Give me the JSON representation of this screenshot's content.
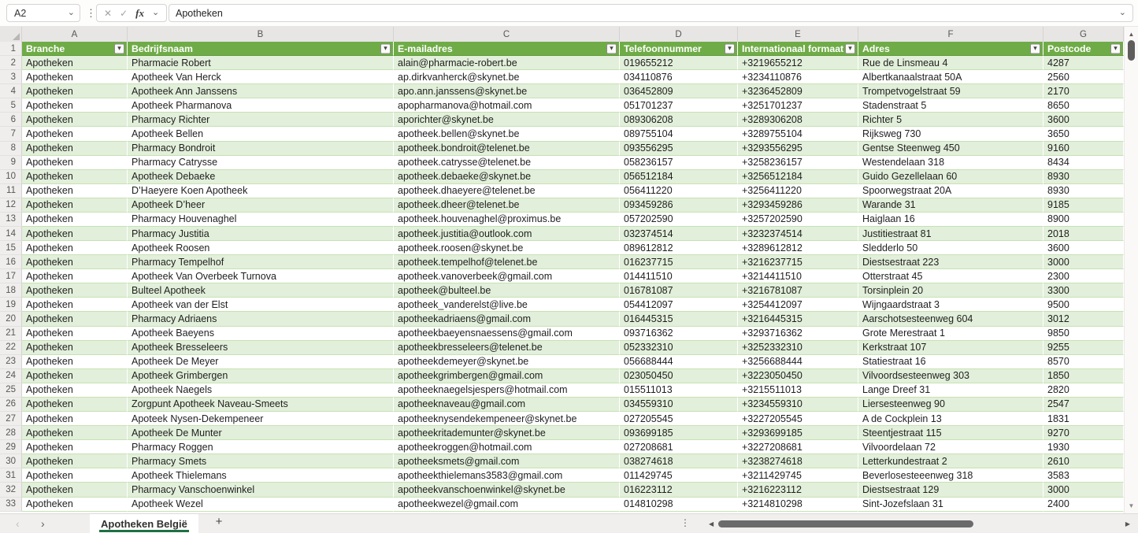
{
  "toolbar": {
    "name_box": "A2",
    "formula_value": "Apotheken",
    "fx_label": "fx"
  },
  "icons": {
    "chevron_down": "⌄",
    "more_vertical": "⋮",
    "cancel": "✕",
    "check": "✓",
    "filter_arrow": "▾",
    "nav_left": "‹",
    "nav_right": "›",
    "scroll_left": "◀",
    "scroll_right": "▶",
    "scroll_up": "▲",
    "scroll_down": "▼",
    "add_sheet": "+"
  },
  "colors": {
    "table_header_green": "#6FAC47",
    "band_green": "#E2EFDA",
    "row_border_green": "#C6E2B4",
    "tab_underline_green": "#1E7145"
  },
  "grid": {
    "column_letters": [
      "A",
      "B",
      "C",
      "D",
      "E",
      "F",
      "G"
    ],
    "headers": [
      "Branche",
      "Bedrijfsnaam",
      "E-mailadres",
      "Telefoonnummer",
      "Internationaal formaat",
      "Adres",
      "Postcode"
    ],
    "rows": [
      [
        "Apotheken",
        "Pharmacie Robert",
        "alain@pharmacie-robert.be",
        "019655212",
        "+3219655212",
        "Rue de Linsmeau 4",
        "4287"
      ],
      [
        "Apotheken",
        "Apotheek Van Herck",
        "ap.dirkvanherck@skynet.be",
        "034110876",
        "+3234110876",
        "Albertkanaalstraat 50A",
        "2560"
      ],
      [
        "Apotheken",
        "Apotheek Ann Janssens",
        "apo.ann.janssens@skynet.be",
        "036452809",
        "+3236452809",
        "Trompetvogelstraat 59",
        "2170"
      ],
      [
        "Apotheken",
        "Apotheek Pharmanova",
        "apopharmanova@hotmail.com",
        "051701237",
        "+3251701237",
        "Stadenstraat 5",
        "8650"
      ],
      [
        "Apotheken",
        "Pharmacy Richter",
        "aporichter@skynet.be",
        "089306208",
        "+3289306208",
        "Richter 5",
        "3600"
      ],
      [
        "Apotheken",
        "Apotheek Bellen",
        "apotheek.bellen@skynet.be",
        "089755104",
        "+3289755104",
        "Rijksweg 730",
        "3650"
      ],
      [
        "Apotheken",
        "Pharmacy Bondroit",
        "apotheek.bondroit@telenet.be",
        "093556295",
        "+3293556295",
        "Gentse Steenweg 450",
        "9160"
      ],
      [
        "Apotheken",
        "Pharmacy Catrysse",
        "apotheek.catrysse@telenet.be",
        "058236157",
        "+3258236157",
        "Westendelaan 318",
        "8434"
      ],
      [
        "Apotheken",
        "Apotheek Debaeke",
        "apotheek.debaeke@skynet.be",
        "056512184",
        "+3256512184",
        "Guido Gezellelaan 60",
        "8930"
      ],
      [
        "Apotheken",
        "D’Haeyere Koen Apotheek",
        "apotheek.dhaeyere@telenet.be",
        "056411220",
        "+3256411220",
        "Spoorwegstraat 20A",
        "8930"
      ],
      [
        "Apotheken",
        "Apotheek D’heer",
        "apotheek.dheer@telenet.be",
        "093459286",
        "+3293459286",
        "Warande 31",
        "9185"
      ],
      [
        "Apotheken",
        "Pharmacy Houvenaghel",
        "apotheek.houvenaghel@proximus.be",
        "057202590",
        "+3257202590",
        "Haiglaan 16",
        "8900"
      ],
      [
        "Apotheken",
        "Pharmacy Justitia",
        "apotheek.justitia@outlook.com",
        "032374514",
        "+3232374514",
        "Justitiestraat 81",
        "2018"
      ],
      [
        "Apotheken",
        "Apotheek Roosen",
        "apotheek.roosen@skynet.be",
        "089612812",
        "+3289612812",
        "Sledderlo 50",
        "3600"
      ],
      [
        "Apotheken",
        "Pharmacy Tempelhof",
        "apotheek.tempelhof@telenet.be",
        "016237715",
        "+3216237715",
        "Diestsestraat 223",
        "3000"
      ],
      [
        "Apotheken",
        "Apotheek Van Overbeek Turnova",
        "apotheek.vanoverbeek@gmail.com",
        "014411510",
        "+3214411510",
        "Otterstraat 45",
        "2300"
      ],
      [
        "Apotheken",
        "Bulteel Apotheek",
        "apotheek@bulteel.be",
        "016781087",
        "+3216781087",
        "Torsinplein 20",
        "3300"
      ],
      [
        "Apotheken",
        "Apotheek van der Elst",
        "apotheek_vanderelst@live.be",
        "054412097",
        "+3254412097",
        "Wijngaardstraat 3",
        "9500"
      ],
      [
        "Apotheken",
        "Pharmacy Adriaens",
        "apotheekadriaens@gmail.com",
        "016445315",
        "+3216445315",
        "Aarschotsesteenweg 604",
        "3012"
      ],
      [
        "Apotheken",
        "Apotheek Baeyens",
        "apotheekbaeyensnaessens@gmail.com",
        "093716362",
        "+3293716362",
        "Grote Merestraat 1",
        "9850"
      ],
      [
        "Apotheken",
        "Apotheek Bresseleers",
        "apotheekbresseleers@telenet.be",
        "052332310",
        "+3252332310",
        "Kerkstraat 107",
        "9255"
      ],
      [
        "Apotheken",
        "Apotheek De Meyer",
        "apotheekdemeyer@skynet.be",
        "056688444",
        "+3256688444",
        "Statiestraat 16",
        "8570"
      ],
      [
        "Apotheken",
        "Apotheek Grimbergen",
        "apotheekgrimbergen@gmail.com",
        "023050450",
        "+3223050450",
        "Vilvoordsesteenweg 303",
        "1850"
      ],
      [
        "Apotheken",
        "Apotheek Naegels",
        "apotheeknaegelsjespers@hotmail.com",
        "015511013",
        "+3215511013",
        "Lange Dreef 31",
        "2820"
      ],
      [
        "Apotheken",
        "Zorgpunt Apotheek Naveau-Smeets",
        "apotheeknaveau@gmail.com",
        "034559310",
        "+3234559310",
        "Liersesteenweg 90",
        "2547"
      ],
      [
        "Apotheken",
        "Apoteek Nysen-Dekempeneer",
        "apotheeknysendekempeneer@skynet.be",
        "027205545",
        "+3227205545",
        "A de Cockplein 13",
        "1831"
      ],
      [
        "Apotheken",
        "Apotheek De Munter",
        "apotheekritademunter@skynet.be",
        "093699185",
        "+3293699185",
        "Steentjestraat 115",
        "9270"
      ],
      [
        "Apotheken",
        "Pharmacy Roggen",
        "apotheekroggen@hotmail.com",
        "027208681",
        "+3227208681",
        "Vilvoordelaan 72",
        "1930"
      ],
      [
        "Apotheken",
        "Pharmacy Smets",
        "apotheeksmets@gmail.com",
        "038274618",
        "+3238274618",
        "Letterkundestraat 2",
        "2610"
      ],
      [
        "Apotheken",
        "Apotheek Thielemans",
        "apotheekthielemans3583@gmail.com",
        "011429745",
        "+3211429745",
        "Beverlosesteeenweg 318",
        "3583"
      ],
      [
        "Apotheken",
        "Pharmacy Vanschoenwinkel",
        "apotheekvanschoenwinkel@skynet.be",
        "016223112",
        "+3216223112",
        "Diestsestraat 129",
        "3000"
      ],
      [
        "Apotheken",
        "Apotheek Wezel",
        "apotheekwezel@gmail.com",
        "014810298",
        "+3214810298",
        "Sint-Jozefslaan 31",
        "2400"
      ]
    ]
  },
  "tab_bar": {
    "sheet_name": "Apotheken België"
  }
}
